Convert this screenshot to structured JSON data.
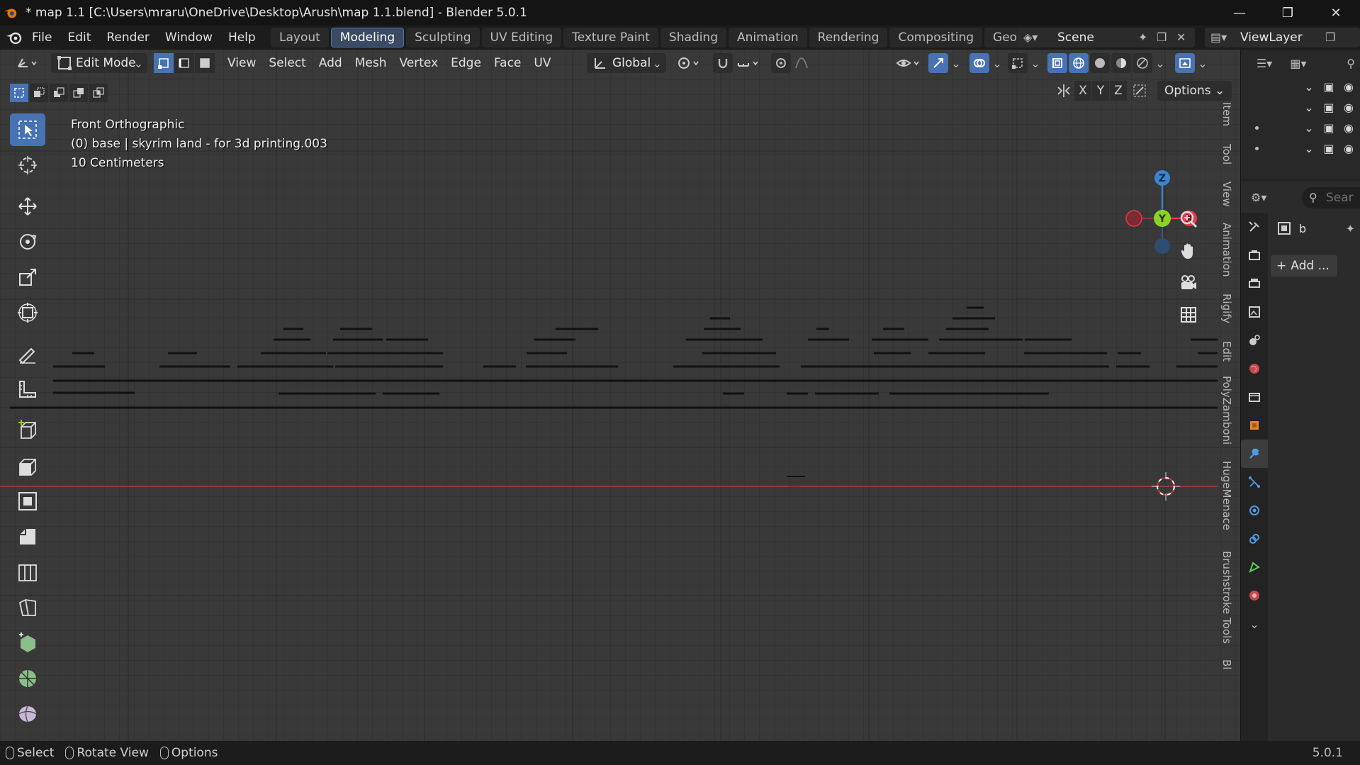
{
  "window": {
    "title": "* map 1.1 [C:\\Users\\mraru\\OneDrive\\Desktop\\Arush\\map 1.1.blend] - Blender 5.0.1"
  },
  "menu": {
    "items": [
      "File",
      "Edit",
      "Render",
      "Window",
      "Help"
    ]
  },
  "workspaces": {
    "tabs": [
      "Layout",
      "Modeling",
      "Sculpting",
      "UV Editing",
      "Texture Paint",
      "Shading",
      "Animation",
      "Rendering",
      "Compositing",
      "Geometr"
    ],
    "active": "Modeling"
  },
  "scene": {
    "name": "Scene"
  },
  "view_layer": {
    "name": "ViewLayer"
  },
  "viewport_header": {
    "mode": "Edit Mode",
    "menus": [
      "View",
      "Select",
      "Add",
      "Mesh",
      "Vertex",
      "Edge",
      "Face",
      "UV"
    ],
    "orientation": "Global"
  },
  "mirror_axes": [
    "X",
    "Y",
    "Z"
  ],
  "options_label": "Options",
  "viewport_info": {
    "view_name": "Front Orthographic",
    "object": "(0) base | skyrim land - for 3d printing.003",
    "scale": "10 Centimeters"
  },
  "gizmo_axes": {
    "z": "Z",
    "y": "Y",
    "x": "X"
  },
  "sidebar_tabs": [
    "Item",
    "Tool",
    "View",
    "Animation",
    "Rigify",
    "Edit",
    "PolyZamboni",
    "HugeMenace",
    "Brushstroke Tools",
    "Bl"
  ],
  "properties": {
    "search_placeholder": "Sear",
    "object_name": "b",
    "add_modifier": "Add ..."
  },
  "statusbar": {
    "items": [
      "Select",
      "Rotate View",
      "Options"
    ],
    "version": "5.0.1"
  },
  "colors": {
    "accent": "#4772b3",
    "axis_x": "#e8394a",
    "axis_y": "#8bd126",
    "axis_z": "#3b84d1"
  }
}
